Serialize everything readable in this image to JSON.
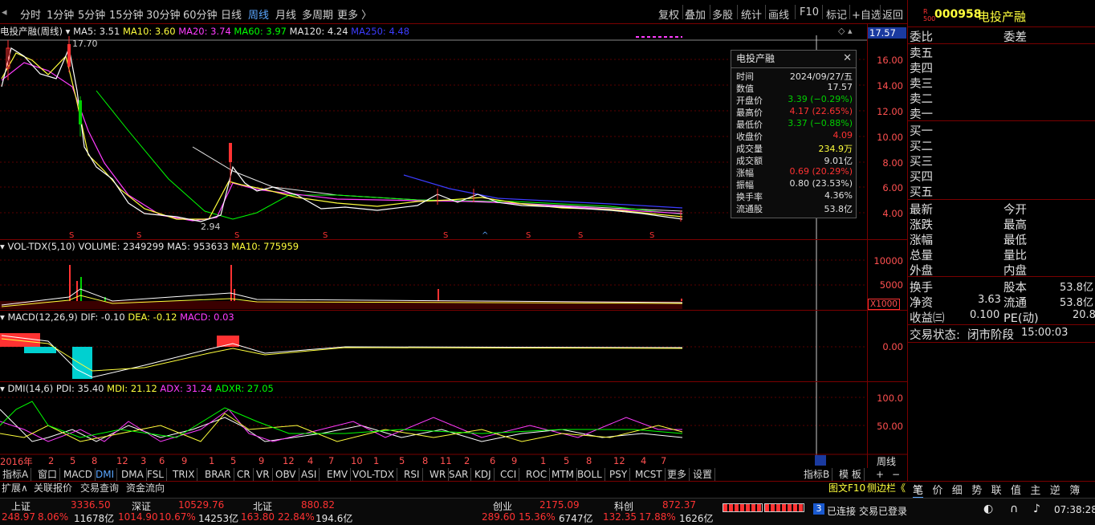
{
  "periods": [
    "分时",
    "1分钟",
    "5分钟",
    "15分钟",
    "30分钟",
    "60分钟",
    "日线",
    "周线",
    "月线",
    "多周期",
    "更多 〉"
  ],
  "tools": [
    "复权",
    "叠加",
    "多股",
    "统计",
    "画线",
    "F10",
    "标记",
    "+自选",
    "返回"
  ],
  "stock": {
    "badge_r": "R",
    "badge_num": "500",
    "code": "000958",
    "name": "电投产融"
  },
  "main_legend": {
    "title": "电投产融(周线)",
    "ma5": "MA5: 3.51",
    "ma10": "MA10: 3.60",
    "ma20": "MA20: 3.74",
    "ma60": "MA60: 3.97",
    "ma120": "MA120: 4.24",
    "ma250": "MA250: 4.48"
  },
  "price_axis": [
    "16.00",
    "14.00",
    "12.00",
    "10.00",
    "8.00",
    "6.00",
    "4.00"
  ],
  "current_price": "17.57",
  "annotations": {
    "high": "17.70",
    "low": "2.94"
  },
  "vol_legend": {
    "name": "VOL-TDX(5,10)",
    "volume": "VOLUME: 2349299",
    "ma5": "MA5: 953633",
    "ma10": "MA10: 775959"
  },
  "vol_axis": [
    "10000",
    "5000"
  ],
  "vol_unit": "X1000",
  "macd_legend": {
    "name": "MACD(12,26,9)",
    "dif": "DIF: -0.10",
    "dea": "DEA: -0.12",
    "macd": "MACD: 0.03"
  },
  "macd_axis": [
    "0.00"
  ],
  "dmi_legend": {
    "name": "DMI(14,6)",
    "pdi": "PDI: 35.40",
    "mdi": "MDI: 21.12",
    "adx": "ADX: 31.24",
    "adxr": "ADXR: 27.05"
  },
  "dmi_axis": [
    "100.0",
    "50.00"
  ],
  "x_labels": [
    "2016年",
    "2",
    "5",
    "8",
    "12",
    "3",
    "6",
    "9",
    "1",
    "5",
    "9",
    "12",
    "4",
    "7",
    "10",
    "1",
    "5",
    "8",
    "11",
    "2",
    "6",
    "9",
    "1",
    "5",
    "8",
    "12",
    "4",
    "7"
  ],
  "x_axis_right": "周线",
  "tooltip": {
    "title": "电投产融",
    "rows": [
      {
        "k": "时间",
        "v": "2024/09/27/五",
        "c": "#e0e0e0"
      },
      {
        "k": "数值",
        "v": "17.57",
        "c": "#e0e0e0"
      },
      {
        "k": "开盘价",
        "v": "3.39 (−0.29%)",
        "c": "#00d000"
      },
      {
        "k": "最高价",
        "v": "4.17 (22.65%)",
        "c": "#ff3232"
      },
      {
        "k": "最低价",
        "v": "3.37 (−0.88%)",
        "c": "#00d000"
      },
      {
        "k": "收盘价",
        "v": "4.09",
        "c": "#ff3232"
      },
      {
        "k": "成交量",
        "v": "234.9万",
        "c": "#ffff3c"
      },
      {
        "k": "成交额",
        "v": "9.01亿",
        "c": "#e0e0e0"
      },
      {
        "k": "涨幅",
        "v": "0.69 (20.29%)",
        "c": "#ff3232"
      },
      {
        "k": "振幅",
        "v": "0.80 (23.53%)",
        "c": "#e0e0e0"
      },
      {
        "k": "换手率",
        "v": "4.36%",
        "c": "#e0e0e0"
      },
      {
        "k": "流通股",
        "v": "53.8亿",
        "c": "#e0e0e0"
      }
    ]
  },
  "orderbook": {
    "weibi": "委比",
    "weicha": "委差",
    "sell": [
      "卖五",
      "卖四",
      "卖三",
      "卖二",
      "卖一"
    ],
    "buy": [
      "买一",
      "买二",
      "买三",
      "买四",
      "买五"
    ]
  },
  "quote": {
    "left": [
      "最新",
      "涨跌",
      "涨幅",
      "总量",
      "外盘"
    ],
    "right": [
      "今开",
      "最高",
      "最低",
      "量比",
      "内盘"
    ],
    "turnover_label": "换手",
    "equity_label": "股本",
    "equity_val": "53.8亿",
    "nav_label": "净资",
    "nav_val": "3.63",
    "float_label": "流通",
    "float_val": "53.8亿",
    "eps_label": "收益㈢",
    "eps_val": "0.100",
    "pe_label": "PE(动)",
    "pe_val": "20.8"
  },
  "trade_status": {
    "label": "交易状态:",
    "state": "闭市阶段",
    "time": "15:00:03"
  },
  "indicator_tabs": [
    "指标A",
    "窗口",
    "MACD",
    "DMI",
    "DMA",
    "FSL",
    "TRIX",
    "BRAR",
    "CR",
    "VR",
    "OBV",
    "ASI",
    "EMV",
    "VOL-TDX",
    "RSI",
    "WR",
    "SAR",
    "KDJ",
    "CCI",
    "ROC",
    "MTM",
    "BOLL",
    "PSY",
    "MCST",
    "更多",
    "设置"
  ],
  "indicator_right": [
    "指标B",
    "模 板",
    "+",
    "−"
  ],
  "sub_tabs": [
    "扩展∧",
    "关联报价",
    "交易查询",
    "资金流向"
  ],
  "side_tabs": {
    "f10": "图文F10",
    "sidebar": "侧边栏《",
    "items": [
      "笔",
      "价",
      "细",
      "势",
      "联",
      "值",
      "主",
      "逆",
      "簿"
    ]
  },
  "status": {
    "sh": {
      "name": "上证",
      "value": "3336.50",
      "chg": "248.97",
      "pct": "8.06%",
      "amt": "11678亿"
    },
    "sz": {
      "name": "深证",
      "value": "10529.76",
      "chg": "1014.90",
      "pct": "10.67%",
      "amt": "14253亿"
    },
    "bz": {
      "name": "北证",
      "value": "880.82",
      "chg": "163.80",
      "pct": "22.84%",
      "amt": "194.6亿"
    },
    "cy": {
      "name": "创业",
      "value": "2175.09",
      "chg": "289.60",
      "pct": "15.36%",
      "amt": "6747亿"
    },
    "kc": {
      "name": "科创",
      "value": "872.37",
      "chg": "132.35",
      "pct": "17.88%",
      "amt": "1626亿"
    },
    "conn_badge": "3",
    "conn": "已连接",
    "trade": "交易已登录",
    "clock": "07:38:28"
  },
  "colors": {
    "up": "#ff3232",
    "down": "#00d000",
    "ma5": "#ffffff",
    "ma10": "#ffff3c",
    "ma20": "#ff3cff",
    "ma60": "#00ff00",
    "ma120": "#e6e6e6",
    "ma250": "#3c3cff"
  }
}
